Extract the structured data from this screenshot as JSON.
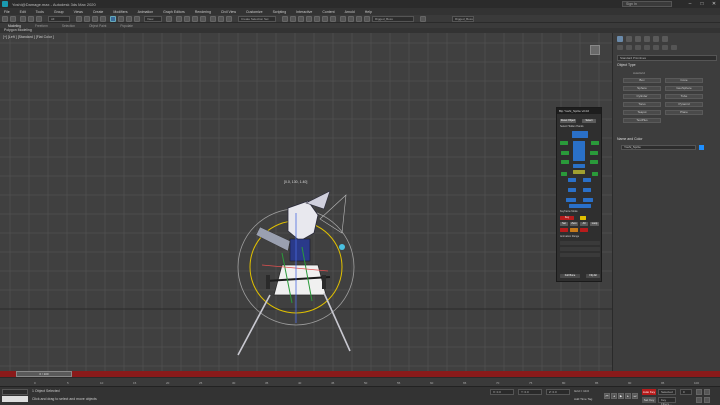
{
  "window": {
    "title": "Yoshi@Damage.max - Autodesk 3ds Max 2020",
    "signin": "Sign In",
    "workspace": "Workspaces: Default"
  },
  "menu": [
    "File",
    "Edit",
    "Tools",
    "Group",
    "Views",
    "Create",
    "Modifiers",
    "Animation",
    "Graph Editors",
    "Rendering",
    "Civil View",
    "Customize",
    "Scripting",
    "Interactive",
    "Content",
    "Arnold",
    "Help"
  ],
  "toolbar": {
    "filter": "All",
    "view": "View",
    "selection_set": "Create Selection Set",
    "named": "Rigged_Boss"
  },
  "ribbon": {
    "tabs": [
      "Modeling",
      "Freeform",
      "Selection",
      "Object Paint",
      "Populate"
    ],
    "mode": "Polygon Modeling"
  },
  "viewport": {
    "label": "[+] [Left ] [Standard ] [Flat Color ]",
    "coords_overlay": "[0.0, 130, 1.40]"
  },
  "command_panel": {
    "category": "Standard Primitives",
    "object_type_title": "Object Type",
    "autogrid": "AutoGrid",
    "objects": [
      "Box",
      "Cone",
      "Sphere",
      "GeoSphere",
      "Cylinder",
      "Tube",
      "Torus",
      "Pyramid",
      "Teapot",
      "Plane",
      "TextPlus"
    ],
    "name_color_title": "Name and Color",
    "name_value": "Yoshi_Sprite"
  },
  "picker": {
    "title": "Bip Yoshi_Sprite v0.02",
    "buttons": {
      "reset": "Reset Object",
      "select": "Select",
      "all_bone": "Select Hidden Hands",
      "key": "Key",
      "set": "Set",
      "zero": "Zero",
      "all": "All",
      "loop": "Loop"
    },
    "keyframe_label": "Keyframe Mode",
    "range_label": "Animation Range",
    "bottom": "Full Bone",
    "bottom2": "Flip All"
  },
  "timeline": {
    "knob": "0 / 100",
    "ticks": [
      "0",
      "5",
      "10",
      "15",
      "20",
      "25",
      "30",
      "35",
      "40",
      "45",
      "50",
      "55",
      "60",
      "65",
      "70",
      "75",
      "80",
      "85",
      "90",
      "95",
      "100"
    ]
  },
  "status": {
    "selected": "1 Object Selected",
    "prompt": "Click and drag to select and move objects",
    "x": "X: 0.0",
    "y": "Y: 0.0",
    "z": "Z: 0.0",
    "grid": "Grid = 10.0",
    "addtime": "Add Time Tag",
    "autokey": "Auto Key",
    "selected_btn": "Selected",
    "setkey": "Set Key",
    "keyfilters": "Key Filters...",
    "frame": "0"
  },
  "colors": {
    "accent": "#1a9ab0",
    "timeline_red": "#8a1a1a",
    "autokey_red": "#b81c1c",
    "gizmo_yellow": "#e0c000",
    "picker_green": "#2a9a3a",
    "picker_blue": "#2a70c8"
  }
}
